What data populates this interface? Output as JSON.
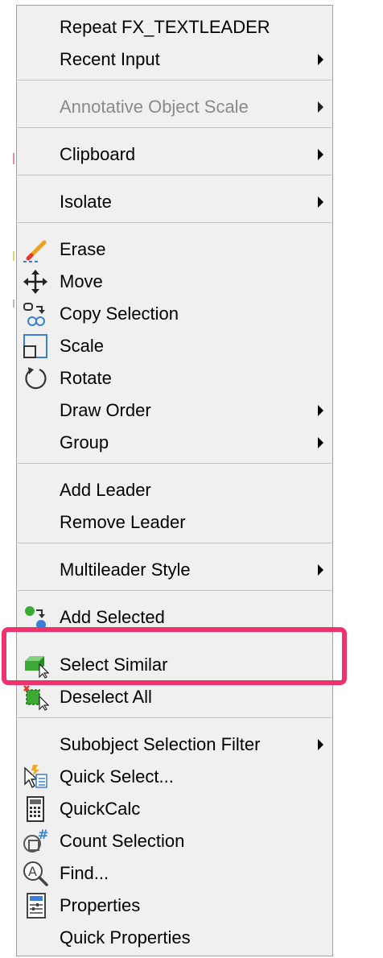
{
  "menu": {
    "items": [
      {
        "label": "Repeat FX_TEXTLEADER",
        "submenu": false,
        "disabled": false
      },
      {
        "label": "Recent Input",
        "submenu": true,
        "disabled": false
      },
      {
        "label": "Annotative Object Scale",
        "submenu": true,
        "disabled": true
      },
      {
        "label": "Clipboard",
        "submenu": true,
        "disabled": false
      },
      {
        "label": "Isolate",
        "submenu": true,
        "disabled": false
      },
      {
        "label": "Erase",
        "icon": "eraser-pencil-icon"
      },
      {
        "label": "Move",
        "icon": "move-arrows-icon"
      },
      {
        "label": "Copy Selection",
        "icon": "copy-selection-icon"
      },
      {
        "label": "Scale",
        "icon": "scale-icon"
      },
      {
        "label": "Rotate",
        "icon": "rotate-icon"
      },
      {
        "label": "Draw Order",
        "submenu": true
      },
      {
        "label": "Group",
        "submenu": true
      },
      {
        "label": "Add Leader"
      },
      {
        "label": "Remove Leader"
      },
      {
        "label": "Multileader Style",
        "submenu": true
      },
      {
        "label": "Add Selected",
        "icon": "add-selected-icon"
      },
      {
        "label": "Select Similar",
        "icon": "select-similar-icon",
        "highlighted": true
      },
      {
        "label": "Deselect All",
        "icon": "deselect-all-icon"
      },
      {
        "label": "Subobject Selection Filter",
        "submenu": true
      },
      {
        "label": "Quick Select...",
        "icon": "quick-select-icon"
      },
      {
        "label": "QuickCalc",
        "icon": "calculator-icon"
      },
      {
        "label": "Count Selection",
        "icon": "count-selection-icon"
      },
      {
        "label": "Find...",
        "icon": "find-text-icon"
      },
      {
        "label": "Properties",
        "icon": "properties-icon"
      },
      {
        "label": "Quick Properties"
      }
    ]
  },
  "colors": {
    "menu_background": "#f0f0f0",
    "highlight_border": "#f0326c",
    "separator": "#bfbfbf",
    "disabled_text": "#8a8a8a"
  }
}
